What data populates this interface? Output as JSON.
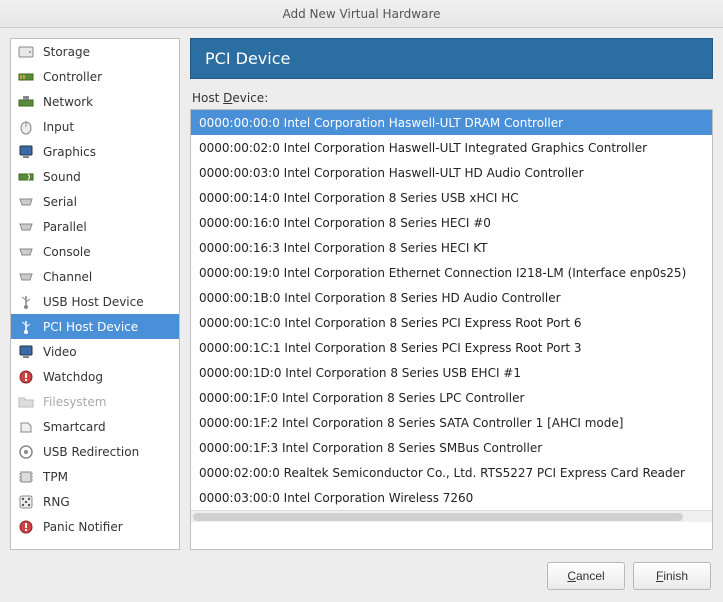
{
  "window": {
    "title": "Add New Virtual Hardware"
  },
  "sidebar": {
    "items": [
      {
        "label": "Storage",
        "icon": "storage-icon"
      },
      {
        "label": "Controller",
        "icon": "controller-icon"
      },
      {
        "label": "Network",
        "icon": "network-icon"
      },
      {
        "label": "Input",
        "icon": "input-icon"
      },
      {
        "label": "Graphics",
        "icon": "graphics-icon"
      },
      {
        "label": "Sound",
        "icon": "sound-icon"
      },
      {
        "label": "Serial",
        "icon": "serial-icon"
      },
      {
        "label": "Parallel",
        "icon": "parallel-icon"
      },
      {
        "label": "Console",
        "icon": "console-icon"
      },
      {
        "label": "Channel",
        "icon": "channel-icon"
      },
      {
        "label": "USB Host Device",
        "icon": "usb-icon"
      },
      {
        "label": "PCI Host Device",
        "icon": "pci-icon",
        "selected": true
      },
      {
        "label": "Video",
        "icon": "video-icon"
      },
      {
        "label": "Watchdog",
        "icon": "watchdog-icon"
      },
      {
        "label": "Filesystem",
        "icon": "filesystem-icon",
        "disabled": true
      },
      {
        "label": "Smartcard",
        "icon": "smartcard-icon"
      },
      {
        "label": "USB Redirection",
        "icon": "usb-redir-icon"
      },
      {
        "label": "TPM",
        "icon": "tpm-icon"
      },
      {
        "label": "RNG",
        "icon": "rng-icon"
      },
      {
        "label": "Panic Notifier",
        "icon": "panic-icon"
      }
    ]
  },
  "panel": {
    "title": "PCI Device",
    "host_device_label_pre": "Host ",
    "host_device_label_u": "D",
    "host_device_label_post": "evice:"
  },
  "devices": [
    {
      "text": "0000:00:00:0 Intel Corporation Haswell-ULT DRAM Controller",
      "selected": true
    },
    {
      "text": "0000:00:02:0 Intel Corporation Haswell-ULT Integrated Graphics Controller"
    },
    {
      "text": "0000:00:03:0 Intel Corporation Haswell-ULT HD Audio Controller"
    },
    {
      "text": "0000:00:14:0 Intel Corporation 8 Series USB xHCI HC"
    },
    {
      "text": "0000:00:16:0 Intel Corporation 8 Series HECI #0"
    },
    {
      "text": "0000:00:16:3 Intel Corporation 8 Series HECI KT"
    },
    {
      "text": "0000:00:19:0 Intel Corporation Ethernet Connection I218-LM (Interface enp0s25)"
    },
    {
      "text": "0000:00:1B:0 Intel Corporation 8 Series HD Audio Controller"
    },
    {
      "text": "0000:00:1C:0 Intel Corporation 8 Series PCI Express Root Port 6"
    },
    {
      "text": "0000:00:1C:1 Intel Corporation 8 Series PCI Express Root Port 3"
    },
    {
      "text": "0000:00:1D:0 Intel Corporation 8 Series USB EHCI #1"
    },
    {
      "text": "0000:00:1F:0 Intel Corporation 8 Series LPC Controller"
    },
    {
      "text": "0000:00:1F:2 Intel Corporation 8 Series SATA Controller 1 [AHCI mode]"
    },
    {
      "text": "0000:00:1F:3 Intel Corporation 8 Series SMBus Controller"
    },
    {
      "text": "0000:02:00:0 Realtek Semiconductor Co., Ltd. RTS5227 PCI Express Card Reader"
    },
    {
      "text": "0000:03:00:0 Intel Corporation Wireless 7260"
    }
  ],
  "buttons": {
    "cancel_u": "C",
    "cancel_post": "ancel",
    "finish_u": "F",
    "finish_post": "inish"
  }
}
